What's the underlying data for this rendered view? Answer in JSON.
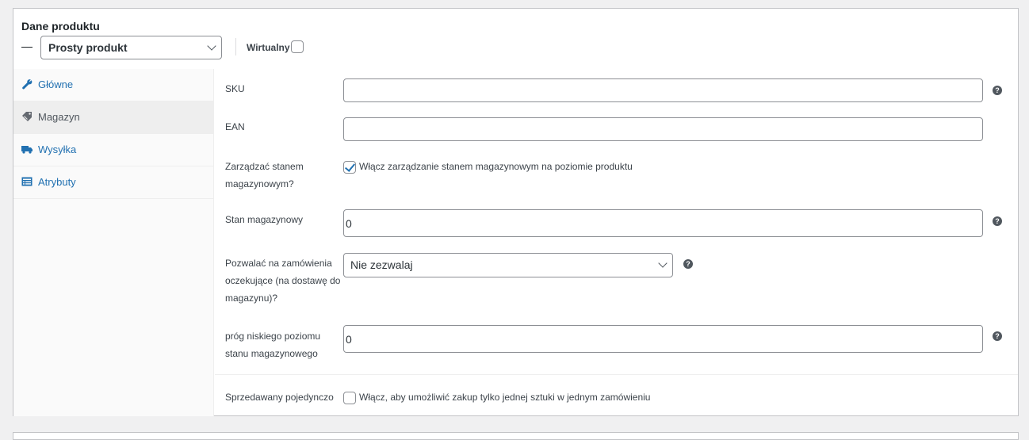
{
  "panel": {
    "title": "Dane produktu",
    "product_type": "Prosty produkt",
    "virtual_label": "Wirtualny",
    "virtual_checked": false
  },
  "tabs": [
    {
      "label": "Główne",
      "icon": "wrench-icon"
    },
    {
      "label": "Magazyn",
      "icon": "tag-icon",
      "active": true
    },
    {
      "label": "Wysyłka",
      "icon": "truck-icon"
    },
    {
      "label": "Atrybuty",
      "icon": "list-icon"
    }
  ],
  "fields": {
    "sku": {
      "label": "SKU",
      "value": ""
    },
    "ean": {
      "label": "EAN",
      "value": ""
    },
    "manage_stock": {
      "label_line1": "Zarządzać stanem",
      "label_line2": "magazynowym?",
      "checkbox_text": "Włącz zarządzanie stanem magazynowym na poziomie produktu",
      "checked": true
    },
    "stock_qty": {
      "label": "Stan magazynowy",
      "value": "0"
    },
    "backorders": {
      "label_line1": "Pozwalać na zamówienia",
      "label_line2": "oczekujące (na dostawę do",
      "label_line3": "magazynu)?",
      "value": "Nie zezwalaj"
    },
    "low_stock": {
      "label_line1": "próg niskiego poziomu",
      "label_line2": "stanu magazynowego",
      "value": "0"
    },
    "sold_individually": {
      "label": "Sprzedawany pojedynczo",
      "checkbox_text": "Włącz, aby umożliwić zakup tylko jednej sztuki w jednym zamówieniu",
      "checked": false
    }
  },
  "colors": {
    "link": "#2271b1",
    "help_icon": "#50575e",
    "active_tab_bg": "#eeeeee"
  }
}
